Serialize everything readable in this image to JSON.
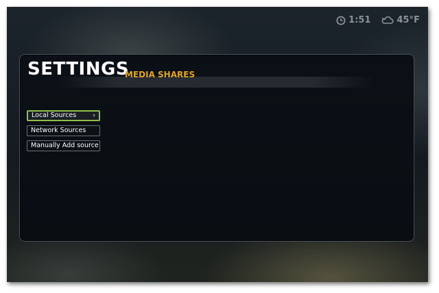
{
  "status": {
    "time": "1:51",
    "temperature": "45°F",
    "clock_icon": "clock-icon",
    "weather_icon": "cloud-icon"
  },
  "header": {
    "title": "SETTINGS",
    "subtitle": "MEDIA SHARES"
  },
  "menu": {
    "items": [
      {
        "label": "Local Sources",
        "selected": true
      },
      {
        "label": "Network Sources",
        "selected": false
      },
      {
        "label": "Manually Add source",
        "selected": false
      }
    ],
    "selected_arrow": "›"
  },
  "colors": {
    "accent": "#e2a71a",
    "selection_border": "#8fc04a",
    "panel_border": "#4a5158"
  }
}
